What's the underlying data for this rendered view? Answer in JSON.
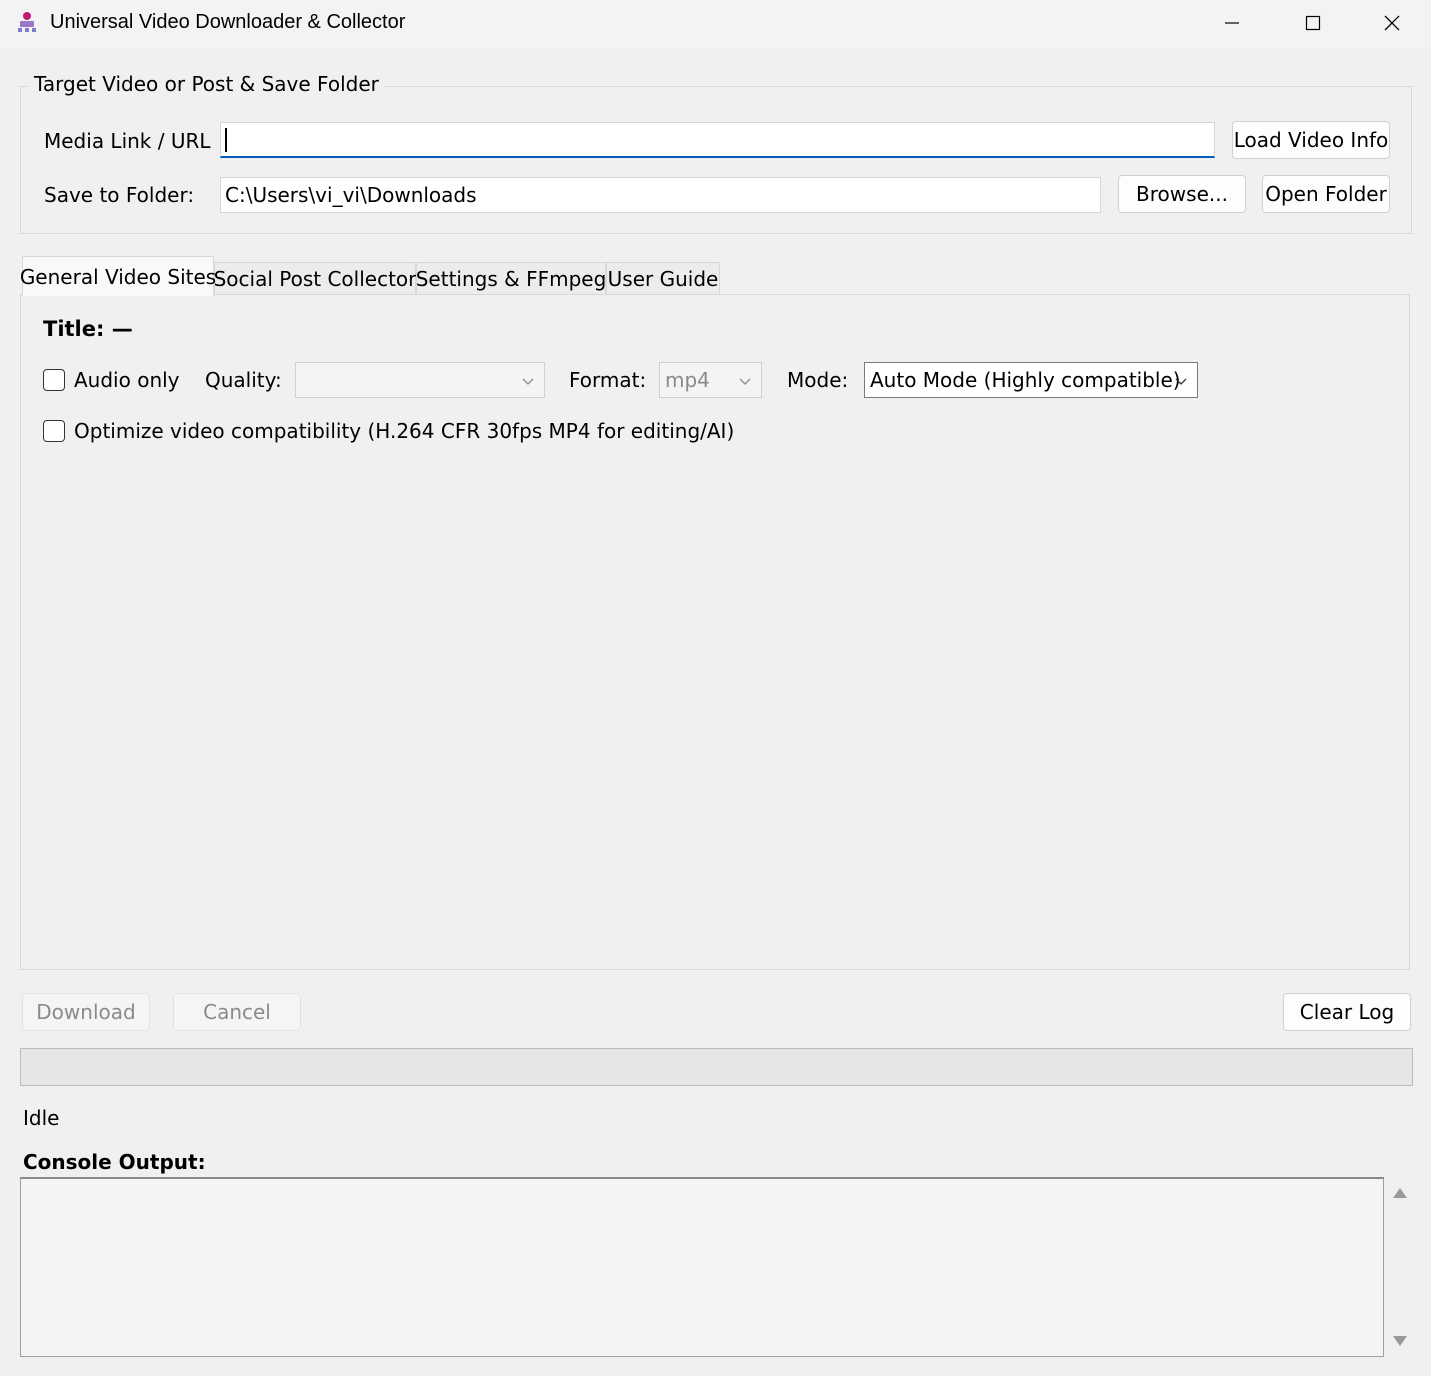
{
  "window": {
    "title": "Universal Video Downloader & Collector",
    "controls": {
      "minimize": "minimize-icon",
      "maximize": "maximize-icon",
      "close": "close-icon"
    }
  },
  "target_group": {
    "title": "Target Video or Post & Save Folder",
    "media_link_label": "Media Link / URL",
    "media_link_value": "",
    "load_button": "Load Video Info",
    "save_label": "Save to Folder:",
    "save_value": "C:\\Users\\vi_vi\\Downloads",
    "browse_button": "Browse...",
    "open_folder_button": "Open Folder"
  },
  "tabs": [
    {
      "label": "General Video Sites",
      "active": true
    },
    {
      "label": "Social Post Collector",
      "active": false
    },
    {
      "label": "Settings & FFmpeg",
      "active": false
    },
    {
      "label": "User Guide",
      "active": false
    }
  ],
  "general_tab": {
    "title_label": "Title: —",
    "audio_only_label": "Audio only",
    "audio_only_checked": false,
    "quality_label": "Quality:",
    "quality_value": "",
    "format_label": "Format:",
    "format_value": "mp4",
    "mode_label": "Mode:",
    "mode_value": "Auto Mode (Highly compatible)",
    "optimize_label": "Optimize video compatibility (H.264 CFR 30fps MP4 for editing/AI)",
    "optimize_checked": false
  },
  "actions": {
    "download_button": "Download",
    "cancel_button": "Cancel",
    "clear_log_button": "Clear Log"
  },
  "progress": {
    "value": 0
  },
  "status_text": "Idle",
  "console": {
    "label": "Console Output:",
    "text": ""
  },
  "colors": {
    "focus_underline": "#005fb8",
    "background": "#f0f0f0"
  }
}
